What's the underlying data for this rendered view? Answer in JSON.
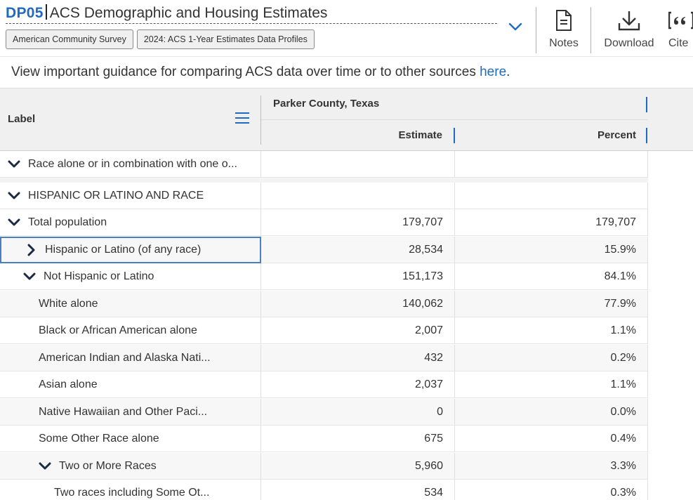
{
  "header": {
    "code": "DP05",
    "title": "ACS Demographic and Housing Estimates",
    "badges": [
      "American Community Survey",
      "2024: ACS 1-Year Estimates Data Profiles"
    ],
    "tools": [
      {
        "label": "Notes",
        "icon": "notes-icon"
      },
      {
        "label": "Download",
        "icon": "download-icon"
      },
      {
        "label": "Cite",
        "icon": "quote-icon"
      }
    ]
  },
  "guidance": {
    "text": "View important guidance for comparing ACS data over time or to other sources ",
    "link": "here",
    "period": "."
  },
  "table": {
    "label_header": "Label",
    "geography": "Parker County, Texas",
    "estimate_header": "Estimate",
    "percent_header": "Percent",
    "rows": [
      {
        "label": "Race alone or in combination with one o...",
        "estimate": "",
        "percent": "",
        "toggle": "collapse",
        "indent": 0
      },
      {
        "label": "HISPANIC OR LATINO AND RACE",
        "estimate": "",
        "percent": "",
        "toggle": "collapse",
        "indent": 0
      },
      {
        "label": "Total population",
        "estimate": "179,707",
        "percent": "179,707",
        "toggle": "collapse",
        "indent": 1
      },
      {
        "label": "Hispanic or Latino (of any race)",
        "estimate": "28,534",
        "percent": "15.9%",
        "toggle": "expand",
        "indent": 2
      },
      {
        "label": "Not Hispanic or Latino",
        "estimate": "151,173",
        "percent": "84.1%",
        "toggle": "collapse",
        "indent": 2
      },
      {
        "label": "White alone",
        "estimate": "140,062",
        "percent": "77.9%",
        "toggle": "none",
        "indent": 3
      },
      {
        "label": "Black or African American alone",
        "estimate": "2,007",
        "percent": "1.1%",
        "toggle": "none",
        "indent": 3
      },
      {
        "label": "American Indian and Alaska Nati...",
        "estimate": "432",
        "percent": "0.2%",
        "toggle": "none",
        "indent": 3
      },
      {
        "label": "Asian alone",
        "estimate": "2,037",
        "percent": "1.1%",
        "toggle": "none",
        "indent": 3
      },
      {
        "label": "Native Hawaiian and Other Paci...",
        "estimate": "0",
        "percent": "0.0%",
        "toggle": "none",
        "indent": 3
      },
      {
        "label": "Some Other Race alone",
        "estimate": "675",
        "percent": "0.4%",
        "toggle": "none",
        "indent": 3
      },
      {
        "label": "Two or More Races",
        "estimate": "5,960",
        "percent": "3.3%",
        "toggle": "collapse",
        "indent": 3
      },
      {
        "label": "Two races including Some Ot...",
        "estimate": "534",
        "percent": "0.3%",
        "toggle": "none",
        "indent": 4
      }
    ]
  },
  "colors": {
    "accent": "#1f6bc4",
    "header_bg": "#f0f0f0",
    "selection": "#4a7fc1"
  }
}
